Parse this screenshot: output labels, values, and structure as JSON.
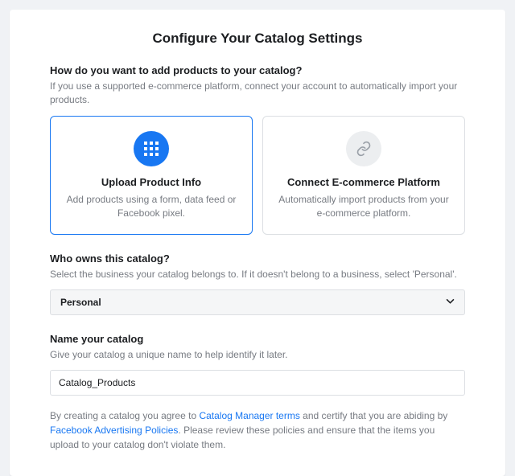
{
  "title": "Configure Your Catalog Settings",
  "s1": {
    "heading": "How do you want to add products to your catalog?",
    "sub": "If you use a supported e-commerce platform, connect your account to automatically import your products.",
    "opt_upload": {
      "title": "Upload Product Info",
      "sub": "Add products using a form, data feed or Facebook pixel."
    },
    "opt_connect": {
      "title": "Connect E-commerce Platform",
      "sub": "Automatically import products from your e-commerce platform."
    }
  },
  "s2": {
    "heading": "Who owns this catalog?",
    "sub": "Select the business your catalog belongs to. If it doesn't belong to a business, select 'Personal'.",
    "value": "Personal"
  },
  "s3": {
    "heading": "Name your catalog",
    "sub": "Give your catalog a unique name to help identify it later.",
    "value": "Catalog_Products"
  },
  "legal": {
    "t1": "By creating a catalog you agree to ",
    "link1": "Catalog Manager terms",
    "t2": " and certify that you are abiding by ",
    "link2": "Facebook Advertising Policies",
    "t3": ". Please review these policies and ensure that the items you upload to your catalog don't violate them."
  }
}
